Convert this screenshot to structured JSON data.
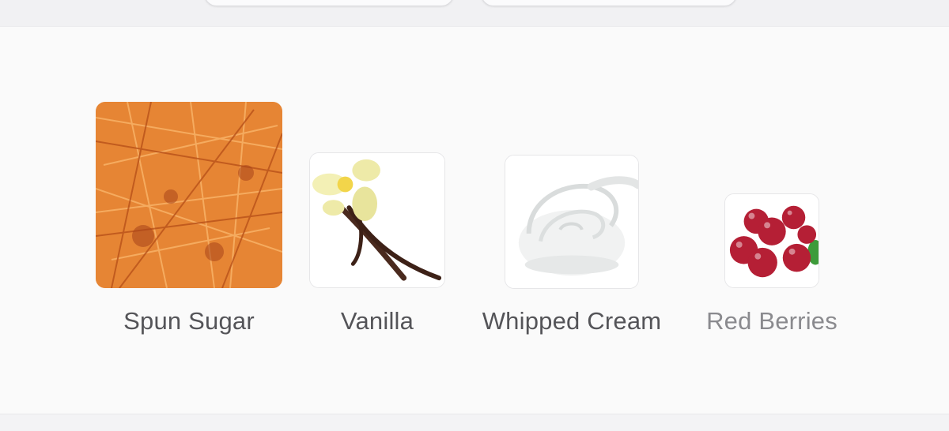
{
  "notes": [
    {
      "label": "Spun Sugar",
      "icon": "spun-sugar-image",
      "emphasis": "primary"
    },
    {
      "label": "Vanilla",
      "icon": "vanilla-image",
      "emphasis": "normal"
    },
    {
      "label": "Whipped Cream",
      "icon": "whipped-cream-image",
      "emphasis": "normal"
    },
    {
      "label": "Red Berries",
      "icon": "red-berries-image",
      "emphasis": "dim"
    }
  ],
  "colors": {
    "label_text": "#545458",
    "label_dim": "#8a8a8e",
    "panel_bg": "#fafafa",
    "sugar": "#d9782a",
    "berry": "#b51f35"
  }
}
